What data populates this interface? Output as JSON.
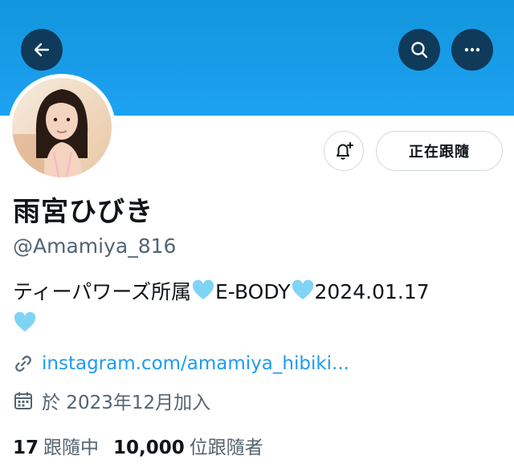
{
  "header": {
    "back_icon": "arrow-left-icon",
    "search_icon": "search-icon",
    "more_icon": "more-horizontal-icon",
    "banner_color": "#1da1f2"
  },
  "profile": {
    "display_name": "雨宮ひびき",
    "handle": "@Amamiya_816",
    "bio_text_1": "ティーパワーズ所属",
    "bio_text_2": "E-BODY",
    "bio_text_3": "2024.01.17",
    "bio_emoji": "light-blue-heart",
    "link": "instagram.com/amamiya_hibiki...",
    "joined": "於 2023年12月加入"
  },
  "actions": {
    "notify_icon": "bell-plus-icon",
    "follow_label": "正在跟隨"
  },
  "stats": {
    "following_count": "17",
    "following_label": "跟隨中",
    "followers_count": "10,000",
    "followers_label": "位跟隨者"
  },
  "colors": {
    "link": "#1d9bf0",
    "secondary_text": "#536471",
    "heart": "#7fd3f5"
  }
}
